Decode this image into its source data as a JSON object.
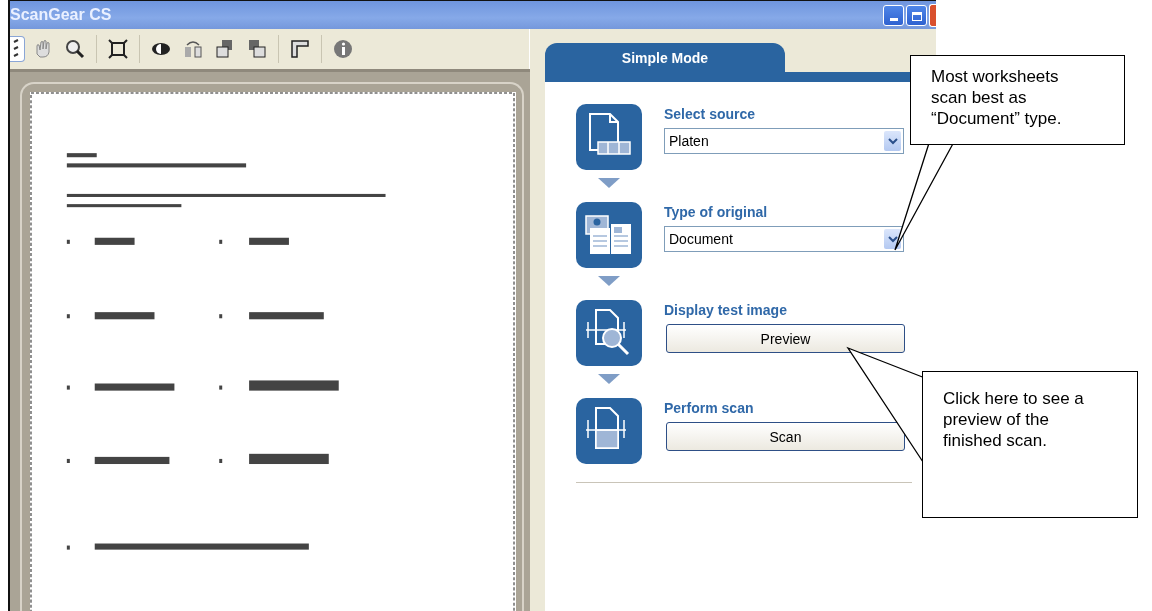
{
  "window": {
    "title": "ScanGear CS"
  },
  "tabs": [
    {
      "label": "Simple Mode",
      "selected": true
    }
  ],
  "steps": [
    {
      "title": "Select source",
      "kind": "dropdown",
      "value": "Platen"
    },
    {
      "title": "Type of original",
      "kind": "dropdown",
      "value": "Document"
    },
    {
      "title": "Display test image",
      "kind": "button",
      "label": "Preview"
    },
    {
      "title": "Perform scan",
      "kind": "button",
      "label": "Scan"
    }
  ],
  "callouts": [
    {
      "text": "Most worksheets scan best as “Document” type."
    },
    {
      "text": "Click here to see a preview of the finished scan."
    }
  ]
}
